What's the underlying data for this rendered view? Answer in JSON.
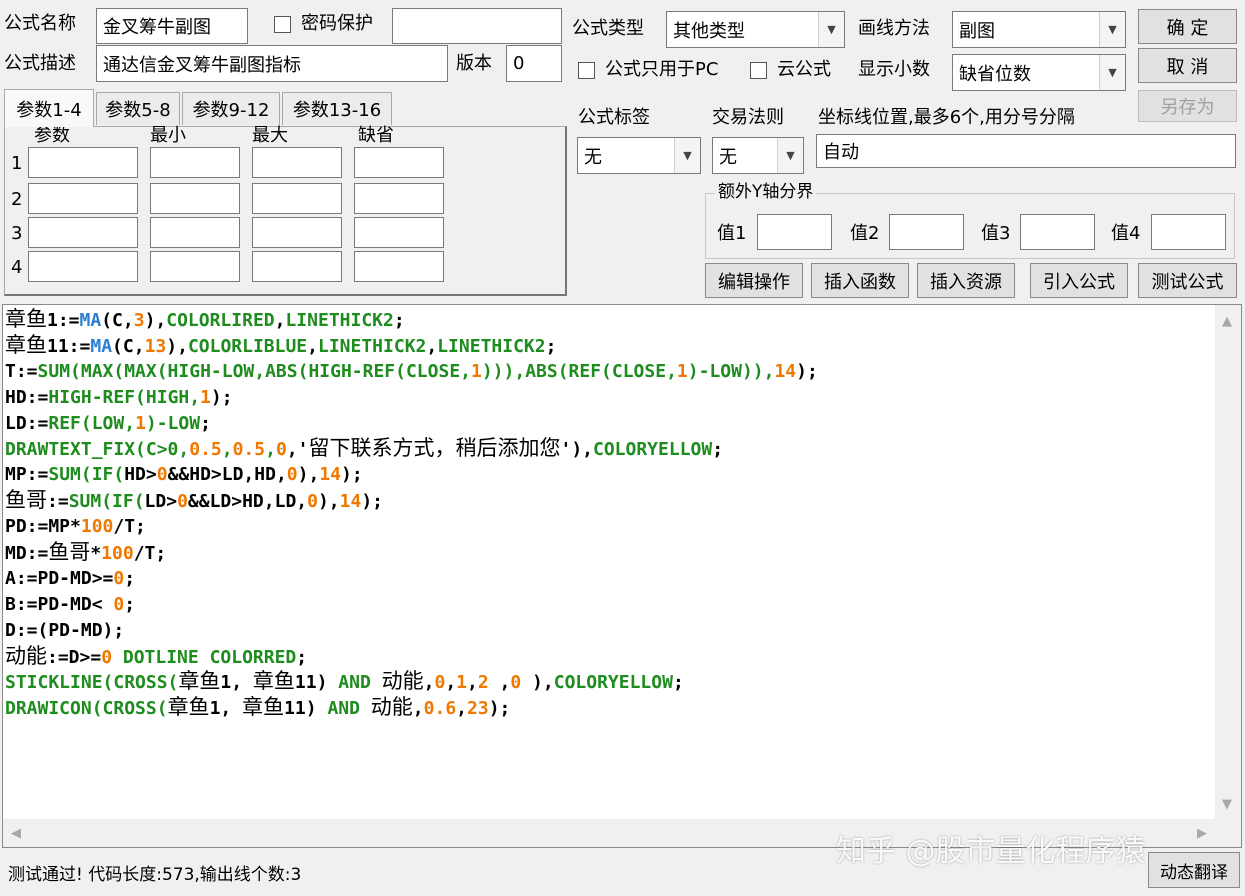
{
  "colors": {
    "keyword": "#1e8c1e",
    "function": "#2a7fd4",
    "number": "#f07800",
    "plain": "#000000"
  },
  "form": {
    "name_label": "公式名称",
    "name_value": "金叉筹牛副图",
    "password_label": "密码保护",
    "password_value": "",
    "desc_label": "公式描述",
    "desc_value": "通达信金叉筹牛副图指标",
    "version_label": "版本",
    "version_value": "0",
    "type_label": "公式类型",
    "type_value": "其他类型",
    "draw_label": "画线方法",
    "draw_value": "副图",
    "pc_only_label": "公式只用于PC",
    "cloud_label": "云公式",
    "decimal_label": "显示小数",
    "decimal_value": "缺省位数",
    "tag_label": "公式标签",
    "tag_value": "无",
    "trade_label": "交易法则",
    "trade_value": "无",
    "axis_label": "坐标线位置,最多6个,用分号分隔",
    "axis_value": "自动"
  },
  "buttons": {
    "ok": "确 定",
    "cancel": "取 消",
    "save_as": "另存为",
    "edit_ops": "编辑操作",
    "insert_func": "插入函数",
    "insert_res": "插入资源",
    "import_formula": "引入公式",
    "test_formula": "测试公式",
    "dynamic_translate": "动态翻译"
  },
  "tabs": [
    "参数1-4",
    "参数5-8",
    "参数9-12",
    "参数13-16"
  ],
  "params": {
    "headers": [
      "参数",
      "最小",
      "最大",
      "缺省"
    ],
    "rows": [
      "1",
      "2",
      "3",
      "4"
    ]
  },
  "yaxis": {
    "title": "额外Y轴分界",
    "labels": [
      "值1",
      "值2",
      "值3",
      "值4"
    ]
  },
  "code_lines": [
    [
      {
        "t": "章鱼",
        "c": "hz"
      },
      {
        "t": "1:="
      },
      {
        "t": "MA",
        "c": "fn"
      },
      {
        "t": "(C,"
      },
      {
        "t": "3",
        "c": "num"
      },
      {
        "t": "),"
      },
      {
        "t": "COLORLIRED",
        "c": "kw"
      },
      {
        "t": ","
      },
      {
        "t": "LINETHICK2",
        "c": "kw"
      },
      {
        "t": ";"
      }
    ],
    [
      {
        "t": "章鱼",
        "c": "hz"
      },
      {
        "t": "11:="
      },
      {
        "t": "MA",
        "c": "fn"
      },
      {
        "t": "(C,"
      },
      {
        "t": "13",
        "c": "num"
      },
      {
        "t": "),"
      },
      {
        "t": "COLORLIBLUE",
        "c": "kw"
      },
      {
        "t": ","
      },
      {
        "t": "LINETHICK2",
        "c": "kw"
      },
      {
        "t": ","
      },
      {
        "t": "LINETHICK2",
        "c": "kw"
      },
      {
        "t": ";"
      }
    ],
    [
      {
        "t": "T:="
      },
      {
        "t": "SUM(MAX(MAX(HIGH-LOW,ABS(HIGH-REF(CLOSE,",
        "c": "kw"
      },
      {
        "t": "1",
        "c": "num"
      },
      {
        "t": "))),ABS(REF(CLOSE,",
        "c": "kw"
      },
      {
        "t": "1",
        "c": "num"
      },
      {
        "t": ")-LOW)),",
        "c": "kw"
      },
      {
        "t": "14",
        "c": "num"
      },
      {
        "t": ");"
      }
    ],
    [
      {
        "t": "HD:="
      },
      {
        "t": "HIGH-REF(HIGH,",
        "c": "kw"
      },
      {
        "t": "1",
        "c": "num"
      },
      {
        "t": ");"
      }
    ],
    [
      {
        "t": "LD:="
      },
      {
        "t": "REF(LOW,",
        "c": "kw"
      },
      {
        "t": "1",
        "c": "num"
      },
      {
        "t": ")-LOW",
        "c": "kw"
      },
      {
        "t": ";"
      }
    ],
    [
      {
        "t": "DRAWTEXT_FIX(C>0,",
        "c": "kw"
      },
      {
        "t": "0.5",
        "c": "num"
      },
      {
        "t": ",",
        "c": "kw"
      },
      {
        "t": "0.5",
        "c": "num"
      },
      {
        "t": ",",
        "c": "kw"
      },
      {
        "t": "0",
        "c": "num"
      },
      {
        "t": ",'"
      },
      {
        "t": "留下联系方式，稍后添加您",
        "c": "hz"
      },
      {
        "t": "'),"
      },
      {
        "t": "COLORYELLOW",
        "c": "kw"
      },
      {
        "t": ";"
      }
    ],
    [
      {
        "t": "MP:="
      },
      {
        "t": "SUM(IF(",
        "c": "kw"
      },
      {
        "t": "HD>"
      },
      {
        "t": "0",
        "c": "num"
      },
      {
        "t": "&&HD>LD,HD,"
      },
      {
        "t": "0",
        "c": "num"
      },
      {
        "t": "),"
      },
      {
        "t": "14",
        "c": "num"
      },
      {
        "t": ");"
      }
    ],
    [
      {
        "t": "鱼哥",
        "c": "hz"
      },
      {
        "t": ":="
      },
      {
        "t": "SUM(IF(",
        "c": "kw"
      },
      {
        "t": "LD>"
      },
      {
        "t": "0",
        "c": "num"
      },
      {
        "t": "&&LD>HD,LD,"
      },
      {
        "t": "0",
        "c": "num"
      },
      {
        "t": "),"
      },
      {
        "t": "14",
        "c": "num"
      },
      {
        "t": ");"
      }
    ],
    [
      {
        "t": "PD:=MP*"
      },
      {
        "t": "100",
        "c": "num"
      },
      {
        "t": "/T;"
      }
    ],
    [
      {
        "t": "MD:="
      },
      {
        "t": "鱼哥",
        "c": "hz"
      },
      {
        "t": "*"
      },
      {
        "t": "100",
        "c": "num"
      },
      {
        "t": "/T;"
      }
    ],
    [
      {
        "t": "A:=PD-MD>="
      },
      {
        "t": "0",
        "c": "num"
      },
      {
        "t": ";"
      }
    ],
    [
      {
        "t": "B:=PD-MD< "
      },
      {
        "t": "0",
        "c": "num"
      },
      {
        "t": ";"
      }
    ],
    [
      {
        "t": "D:=(PD-MD);"
      }
    ],
    [
      {
        "t": "动能",
        "c": "hz"
      },
      {
        "t": ":=D>="
      },
      {
        "t": "0",
        "c": "num"
      },
      {
        "t": " "
      },
      {
        "t": "DOTLINE COLORRED",
        "c": "kw"
      },
      {
        "t": ";"
      }
    ],
    [
      {
        "t": "STICKLINE(CROSS(",
        "c": "kw"
      },
      {
        "t": "章鱼",
        "c": "hz"
      },
      {
        "t": "1, "
      },
      {
        "t": "章鱼",
        "c": "hz"
      },
      {
        "t": "11) "
      },
      {
        "t": "AND",
        "c": "kw"
      },
      {
        "t": " "
      },
      {
        "t": "动能",
        "c": "hz"
      },
      {
        "t": ","
      },
      {
        "t": "0",
        "c": "num"
      },
      {
        "t": ","
      },
      {
        "t": "1",
        "c": "num"
      },
      {
        "t": ","
      },
      {
        "t": "2",
        "c": "num"
      },
      {
        "t": " ,"
      },
      {
        "t": "0",
        "c": "num"
      },
      {
        "t": " ),"
      },
      {
        "t": "COLORYELLOW",
        "c": "kw"
      },
      {
        "t": ";"
      }
    ],
    [
      {
        "t": "DRAWICON(CROSS(",
        "c": "kw"
      },
      {
        "t": "章鱼",
        "c": "hz"
      },
      {
        "t": "1, "
      },
      {
        "t": "章鱼",
        "c": "hz"
      },
      {
        "t": "11) "
      },
      {
        "t": "AND",
        "c": "kw"
      },
      {
        "t": " "
      },
      {
        "t": "动能",
        "c": "hz"
      },
      {
        "t": ","
      },
      {
        "t": "0.6",
        "c": "num"
      },
      {
        "t": ","
      },
      {
        "t": "23",
        "c": "num"
      },
      {
        "t": ");"
      }
    ]
  ],
  "status_text": "测试通过! 代码长度:573,输出线个数:3",
  "watermark": "知乎 @股市量化程序猿"
}
